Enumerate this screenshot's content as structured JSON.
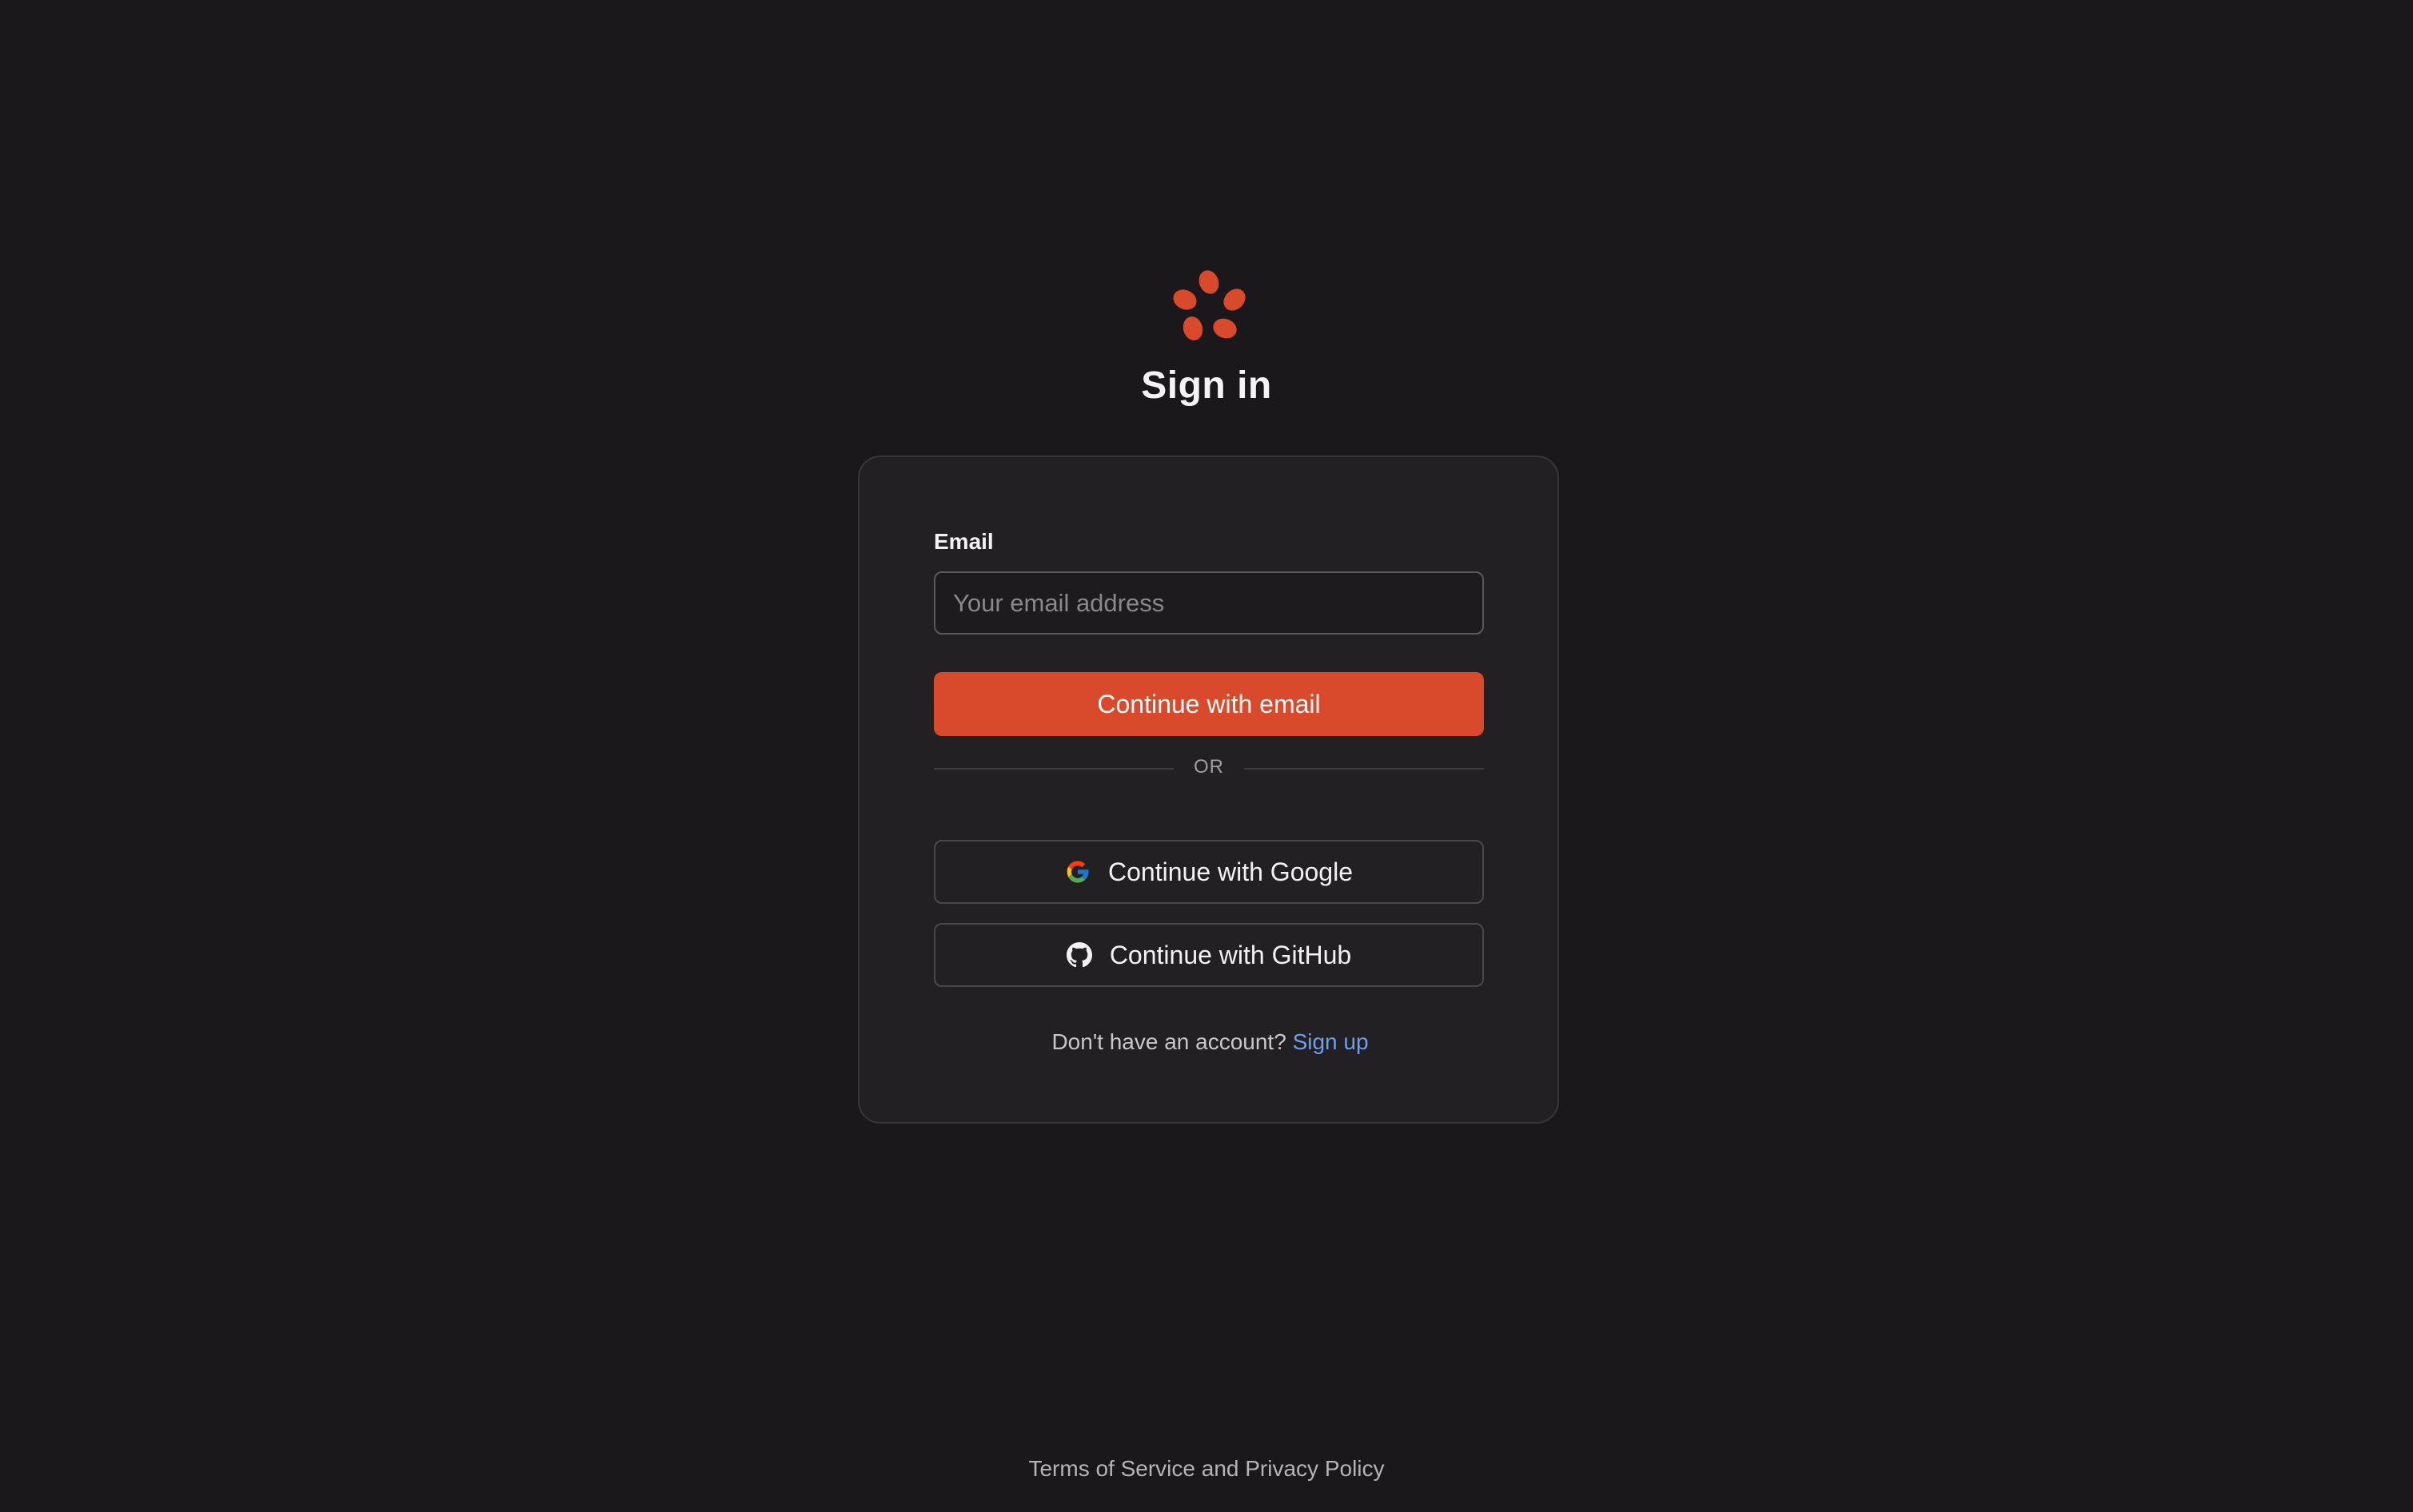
{
  "brand": {
    "logo_icon": "seed-flower-logo-icon",
    "accent_color": "#d9492c"
  },
  "page": {
    "title": "Sign in"
  },
  "form": {
    "email_label": "Email",
    "email_placeholder": "Your email address",
    "email_value": "",
    "continue_email_label": "Continue with email",
    "divider_label": "OR",
    "google_label": "Continue with Google",
    "google_icon": "google-icon",
    "github_label": "Continue with GitHub",
    "github_icon": "github-icon",
    "signup_prompt": "Don't have an account?",
    "signup_link": "Sign up"
  },
  "footer": {
    "terms": "Terms of Service",
    "and": "and",
    "privacy": "Privacy Policy"
  }
}
